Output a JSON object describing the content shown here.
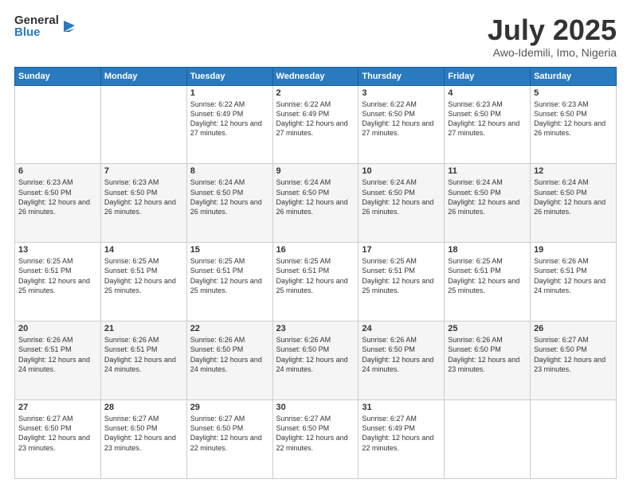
{
  "logo": {
    "general": "General",
    "blue": "Blue"
  },
  "header": {
    "month": "July 2025",
    "location": "Awo-Idemili, Imo, Nigeria"
  },
  "weekdays": [
    "Sunday",
    "Monday",
    "Tuesday",
    "Wednesday",
    "Thursday",
    "Friday",
    "Saturday"
  ],
  "weeks": [
    [
      {
        "day": "",
        "info": ""
      },
      {
        "day": "",
        "info": ""
      },
      {
        "day": "1",
        "info": "Sunrise: 6:22 AM\nSunset: 6:49 PM\nDaylight: 12 hours and 27 minutes."
      },
      {
        "day": "2",
        "info": "Sunrise: 6:22 AM\nSunset: 6:49 PM\nDaylight: 12 hours and 27 minutes."
      },
      {
        "day": "3",
        "info": "Sunrise: 6:22 AM\nSunset: 6:50 PM\nDaylight: 12 hours and 27 minutes."
      },
      {
        "day": "4",
        "info": "Sunrise: 6:23 AM\nSunset: 6:50 PM\nDaylight: 12 hours and 27 minutes."
      },
      {
        "day": "5",
        "info": "Sunrise: 6:23 AM\nSunset: 6:50 PM\nDaylight: 12 hours and 26 minutes."
      }
    ],
    [
      {
        "day": "6",
        "info": "Sunrise: 6:23 AM\nSunset: 6:50 PM\nDaylight: 12 hours and 26 minutes."
      },
      {
        "day": "7",
        "info": "Sunrise: 6:23 AM\nSunset: 6:50 PM\nDaylight: 12 hours and 26 minutes."
      },
      {
        "day": "8",
        "info": "Sunrise: 6:24 AM\nSunset: 6:50 PM\nDaylight: 12 hours and 26 minutes."
      },
      {
        "day": "9",
        "info": "Sunrise: 6:24 AM\nSunset: 6:50 PM\nDaylight: 12 hours and 26 minutes."
      },
      {
        "day": "10",
        "info": "Sunrise: 6:24 AM\nSunset: 6:50 PM\nDaylight: 12 hours and 26 minutes."
      },
      {
        "day": "11",
        "info": "Sunrise: 6:24 AM\nSunset: 6:50 PM\nDaylight: 12 hours and 26 minutes."
      },
      {
        "day": "12",
        "info": "Sunrise: 6:24 AM\nSunset: 6:50 PM\nDaylight: 12 hours and 26 minutes."
      }
    ],
    [
      {
        "day": "13",
        "info": "Sunrise: 6:25 AM\nSunset: 6:51 PM\nDaylight: 12 hours and 25 minutes."
      },
      {
        "day": "14",
        "info": "Sunrise: 6:25 AM\nSunset: 6:51 PM\nDaylight: 12 hours and 25 minutes."
      },
      {
        "day": "15",
        "info": "Sunrise: 6:25 AM\nSunset: 6:51 PM\nDaylight: 12 hours and 25 minutes."
      },
      {
        "day": "16",
        "info": "Sunrise: 6:25 AM\nSunset: 6:51 PM\nDaylight: 12 hours and 25 minutes."
      },
      {
        "day": "17",
        "info": "Sunrise: 6:25 AM\nSunset: 6:51 PM\nDaylight: 12 hours and 25 minutes."
      },
      {
        "day": "18",
        "info": "Sunrise: 6:25 AM\nSunset: 6:51 PM\nDaylight: 12 hours and 25 minutes."
      },
      {
        "day": "19",
        "info": "Sunrise: 6:26 AM\nSunset: 6:51 PM\nDaylight: 12 hours and 24 minutes."
      }
    ],
    [
      {
        "day": "20",
        "info": "Sunrise: 6:26 AM\nSunset: 6:51 PM\nDaylight: 12 hours and 24 minutes."
      },
      {
        "day": "21",
        "info": "Sunrise: 6:26 AM\nSunset: 6:51 PM\nDaylight: 12 hours and 24 minutes."
      },
      {
        "day": "22",
        "info": "Sunrise: 6:26 AM\nSunset: 6:50 PM\nDaylight: 12 hours and 24 minutes."
      },
      {
        "day": "23",
        "info": "Sunrise: 6:26 AM\nSunset: 6:50 PM\nDaylight: 12 hours and 24 minutes."
      },
      {
        "day": "24",
        "info": "Sunrise: 6:26 AM\nSunset: 6:50 PM\nDaylight: 12 hours and 24 minutes."
      },
      {
        "day": "25",
        "info": "Sunrise: 6:26 AM\nSunset: 6:50 PM\nDaylight: 12 hours and 23 minutes."
      },
      {
        "day": "26",
        "info": "Sunrise: 6:27 AM\nSunset: 6:50 PM\nDaylight: 12 hours and 23 minutes."
      }
    ],
    [
      {
        "day": "27",
        "info": "Sunrise: 6:27 AM\nSunset: 6:50 PM\nDaylight: 12 hours and 23 minutes."
      },
      {
        "day": "28",
        "info": "Sunrise: 6:27 AM\nSunset: 6:50 PM\nDaylight: 12 hours and 23 minutes."
      },
      {
        "day": "29",
        "info": "Sunrise: 6:27 AM\nSunset: 6:50 PM\nDaylight: 12 hours and 22 minutes."
      },
      {
        "day": "30",
        "info": "Sunrise: 6:27 AM\nSunset: 6:50 PM\nDaylight: 12 hours and 22 minutes."
      },
      {
        "day": "31",
        "info": "Sunrise: 6:27 AM\nSunset: 6:49 PM\nDaylight: 12 hours and 22 minutes."
      },
      {
        "day": "",
        "info": ""
      },
      {
        "day": "",
        "info": ""
      }
    ]
  ]
}
